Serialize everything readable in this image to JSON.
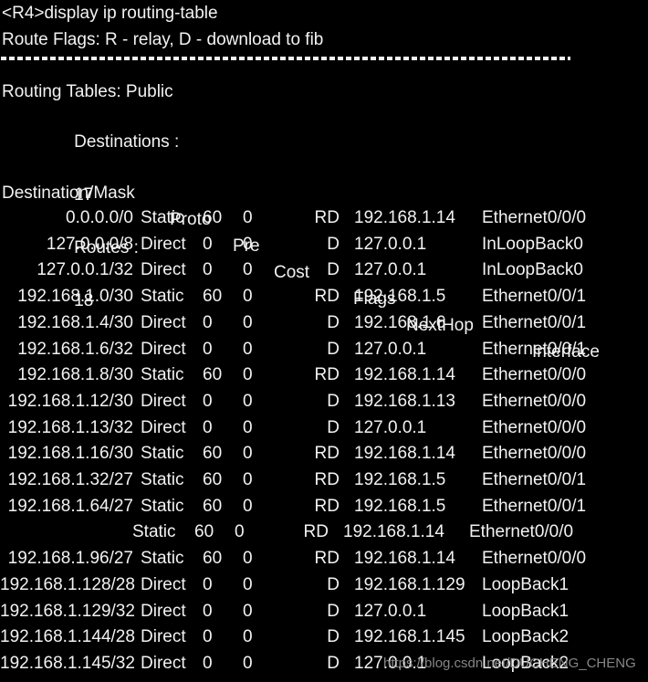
{
  "terminal": {
    "background_color": "#000000",
    "text_color": "#f2f2f2",
    "prompt_line": "<R4>display ip routing-table",
    "route_flags_line": "Route Flags: R - relay, D - download to fib",
    "separator": "------------------------------------------------------------------------------",
    "routing_tables_line": "Routing Tables: Public",
    "summary": {
      "destinations_label": "Destinations :",
      "destinations_value": "17",
      "routes_label": "Routes :",
      "routes_value": "18"
    },
    "columns": {
      "destination": "Destination/Mask",
      "proto": "Proto",
      "pre": "Pre",
      "cost": "Cost",
      "flags": "Flags",
      "nexthop": "NextHop",
      "interface": "Interface"
    },
    "routes": [
      {
        "dest": "0.0.0.0/0",
        "proto": "Static",
        "pre": "60",
        "cost": "0",
        "flags": "RD",
        "nexthop": "192.168.1.14",
        "interface": "Ethernet0/0/0",
        "shifted": false
      },
      {
        "dest": "127.0.0.0/8",
        "proto": "Direct",
        "pre": "0",
        "cost": "0",
        "flags": "D",
        "nexthop": "127.0.0.1",
        "interface": "InLoopBack0",
        "shifted": false
      },
      {
        "dest": "127.0.0.1/32",
        "proto": "Direct",
        "pre": "0",
        "cost": "0",
        "flags": "D",
        "nexthop": "127.0.0.1",
        "interface": "InLoopBack0",
        "shifted": false
      },
      {
        "dest": "192.168.1.0/30",
        "proto": "Static",
        "pre": "60",
        "cost": "0",
        "flags": "RD",
        "nexthop": "192.168.1.5",
        "interface": "Ethernet0/0/1",
        "shifted": false
      },
      {
        "dest": "192.168.1.4/30",
        "proto": "Direct",
        "pre": "0",
        "cost": "0",
        "flags": "D",
        "nexthop": "192.168.1.6",
        "interface": "Ethernet0/0/1",
        "shifted": false
      },
      {
        "dest": "192.168.1.6/32",
        "proto": "Direct",
        "pre": "0",
        "cost": "0",
        "flags": "D",
        "nexthop": "127.0.0.1",
        "interface": "Ethernet0/0/1",
        "shifted": false
      },
      {
        "dest": "192.168.1.8/30",
        "proto": "Static",
        "pre": "60",
        "cost": "0",
        "flags": "RD",
        "nexthop": "192.168.1.14",
        "interface": "Ethernet0/0/0",
        "shifted": false
      },
      {
        "dest": "192.168.1.12/30",
        "proto": "Direct",
        "pre": "0",
        "cost": "0",
        "flags": "D",
        "nexthop": "192.168.1.13",
        "interface": "Ethernet0/0/0",
        "shifted": false
      },
      {
        "dest": "192.168.1.13/32",
        "proto": "Direct",
        "pre": "0",
        "cost": "0",
        "flags": "D",
        "nexthop": "127.0.0.1",
        "interface": "Ethernet0/0/0",
        "shifted": false
      },
      {
        "dest": "192.168.1.16/30",
        "proto": "Static",
        "pre": "60",
        "cost": "0",
        "flags": "RD",
        "nexthop": "192.168.1.14",
        "interface": "Ethernet0/0/0",
        "shifted": false
      },
      {
        "dest": "192.168.1.32/27",
        "proto": "Static",
        "pre": "60",
        "cost": "0",
        "flags": "RD",
        "nexthop": "192.168.1.5",
        "interface": "Ethernet0/0/1",
        "shifted": false
      },
      {
        "dest": "192.168.1.64/27",
        "proto": "Static",
        "pre": "60",
        "cost": "0",
        "flags": "RD",
        "nexthop": "192.168.1.5",
        "interface": "Ethernet0/0/1",
        "shifted": false
      },
      {
        "dest": "",
        "proto": "Static",
        "pre": "60",
        "cost": "0",
        "flags": "RD",
        "nexthop": "192.168.1.14",
        "interface": "Ethernet0/0/0",
        "shifted": true
      },
      {
        "dest": "192.168.1.96/27",
        "proto": "Static",
        "pre": "60",
        "cost": "0",
        "flags": "RD",
        "nexthop": "192.168.1.14",
        "interface": "Ethernet0/0/0",
        "shifted": false
      },
      {
        "dest": "192.168.1.128/28",
        "proto": "Direct",
        "pre": "0",
        "cost": "0",
        "flags": "D",
        "nexthop": "192.168.1.129",
        "interface": "LoopBack1",
        "shifted": false
      },
      {
        "dest": "192.168.1.129/32",
        "proto": "Direct",
        "pre": "0",
        "cost": "0",
        "flags": "D",
        "nexthop": "127.0.0.1",
        "interface": "LoopBack1",
        "shifted": false
      },
      {
        "dest": "192.168.1.144/28",
        "proto": "Direct",
        "pre": "0",
        "cost": "0",
        "flags": "D",
        "nexthop": "192.168.1.145",
        "interface": "LoopBack2",
        "shifted": false
      },
      {
        "dest": "192.168.1.145/32",
        "proto": "Direct",
        "pre": "0",
        "cost": "0",
        "flags": "D",
        "nexthop": "127.0.0.1",
        "interface": "LoopBack2",
        "shifted": false
      }
    ],
    "watermark": "https://blog.csdn.net/DUCHENG_CHENG"
  }
}
